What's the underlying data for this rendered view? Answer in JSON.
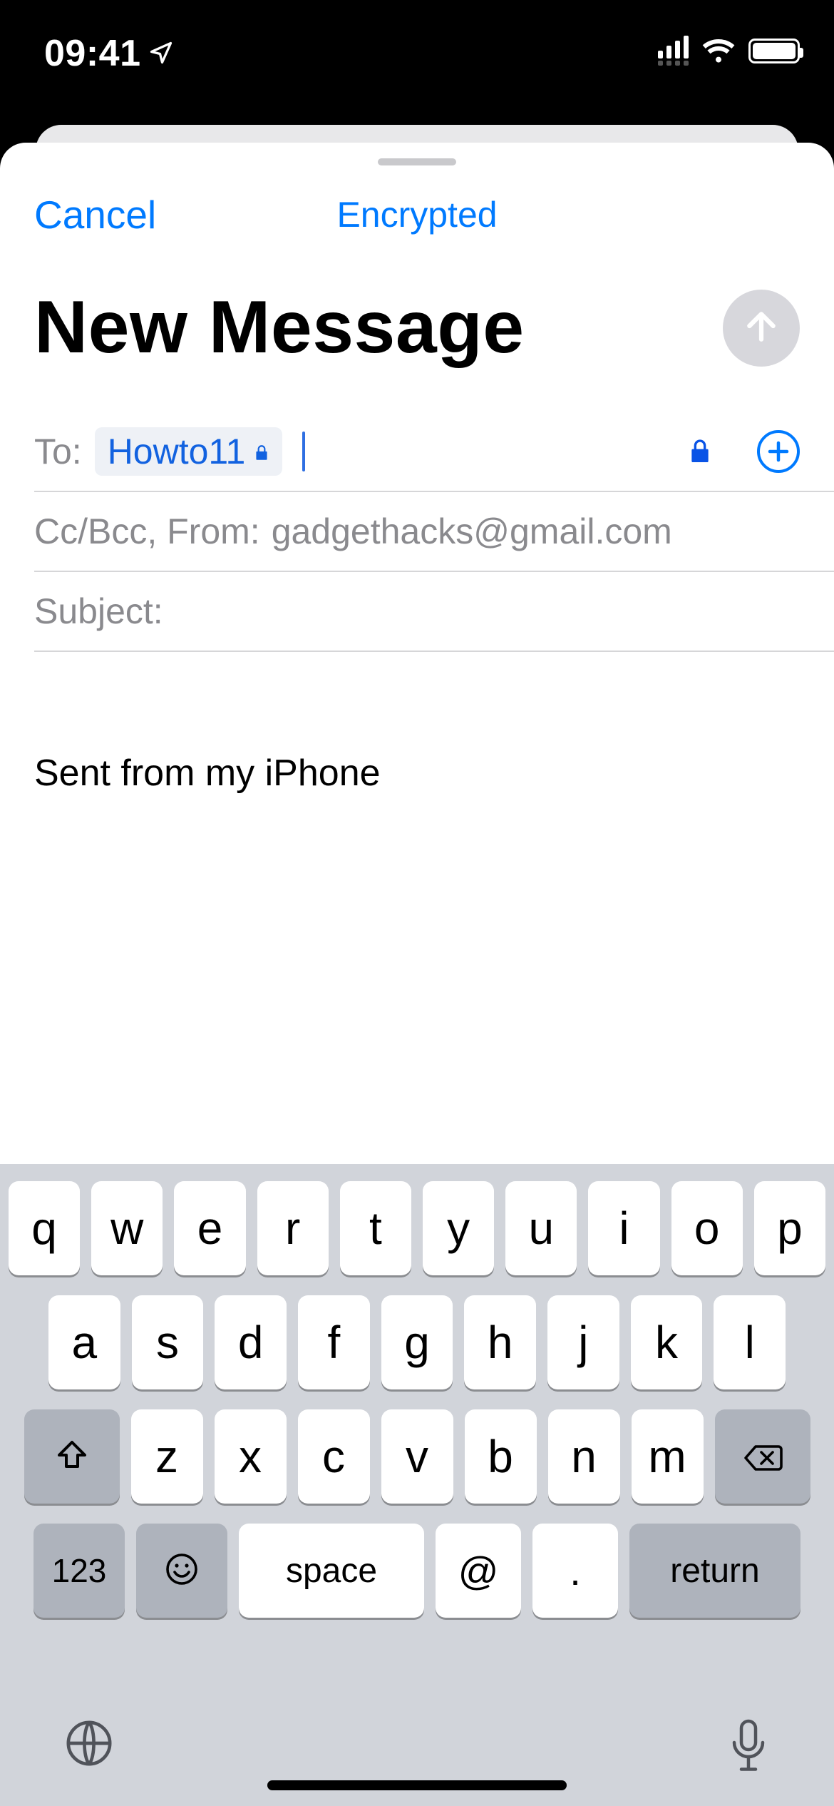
{
  "status": {
    "time": "09:41"
  },
  "nav": {
    "cancel": "Cancel",
    "encrypted": "Encrypted"
  },
  "title": "New Message",
  "fields": {
    "to_label": "To:",
    "to_recipient": "Howto11",
    "cc_from_label": "Cc/Bcc, From:",
    "from_value": "gadgethacks@gmail.com",
    "subject_label": "Subject:"
  },
  "body": {
    "signature": "Sent from my iPhone"
  },
  "keyboard": {
    "row1": [
      "q",
      "w",
      "e",
      "r",
      "t",
      "y",
      "u",
      "i",
      "o",
      "p"
    ],
    "row2": [
      "a",
      "s",
      "d",
      "f",
      "g",
      "h",
      "j",
      "k",
      "l"
    ],
    "row3": [
      "z",
      "x",
      "c",
      "v",
      "b",
      "n",
      "m"
    ],
    "k123": "123",
    "space": "space",
    "at": "@",
    "dot": ".",
    "ret": "return"
  }
}
